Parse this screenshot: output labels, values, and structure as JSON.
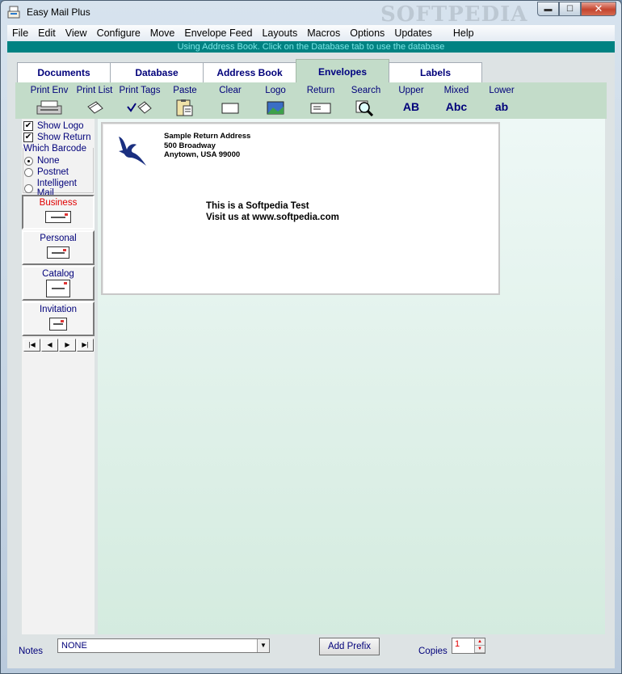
{
  "window": {
    "title": "Easy Mail Plus",
    "watermark": "SOFTPEDIA",
    "controls": {
      "minimize": "▬",
      "maximize": "☐",
      "close": "✕"
    }
  },
  "menu": [
    "File",
    "Edit",
    "View",
    "Configure",
    "Move",
    "Envelope Feed",
    "Layouts",
    "Macros",
    "Options",
    "Updates",
    "Help"
  ],
  "status_message": "Using Address Book. Click on the Database tab to use the database",
  "tabs": [
    {
      "label": "Documents",
      "active": false
    },
    {
      "label": "Database",
      "active": false
    },
    {
      "label": "Address Book",
      "active": false
    },
    {
      "label": "Envelopes",
      "active": true
    },
    {
      "label": "Labels",
      "active": false
    }
  ],
  "toolbar": [
    {
      "label": "Print Env",
      "icon": "printer-icon"
    },
    {
      "label": "Print List",
      "icon": "tags-icon"
    },
    {
      "label": "Print Tags",
      "icon": "check-tags-icon"
    },
    {
      "label": "Paste",
      "icon": "paste-icon"
    },
    {
      "label": "Clear",
      "icon": "blank-envelope-icon"
    },
    {
      "label": "Logo",
      "icon": "logo-image-icon"
    },
    {
      "label": "Return",
      "icon": "return-address-icon"
    },
    {
      "label": "Search",
      "icon": "magnifier-icon"
    },
    {
      "label": "Upper",
      "text": "AB"
    },
    {
      "label": "Mixed",
      "text": "Abc"
    },
    {
      "label": "Lower",
      "text": "ab"
    }
  ],
  "options": {
    "show_logo": {
      "label": "Show Logo",
      "checked": true
    },
    "show_return": {
      "label": "Show Return",
      "checked": true
    },
    "barcode_title": "Which Barcode",
    "barcode_options": [
      {
        "label": "None",
        "selected": true
      },
      {
        "label": "Postnet",
        "selected": false
      },
      {
        "label": "Intelligent Mail",
        "selected": false
      }
    ]
  },
  "envelope_types": [
    {
      "label": "Business",
      "selected": true
    },
    {
      "label": "Personal",
      "selected": false
    },
    {
      "label": "Catalog",
      "selected": false
    },
    {
      "label": "Invitation",
      "selected": false
    }
  ],
  "nav_buttons": [
    "|◀",
    "◀",
    "▶",
    "▶|"
  ],
  "envelope": {
    "return_address": [
      "Sample Return Address",
      "500 Broadway",
      "Anytown,  USA  99000"
    ],
    "address": [
      "This is a Softpedia Test",
      "Visit us at www.softpedia.com"
    ]
  },
  "bottom": {
    "notes_label": "Notes",
    "notes_value": "NONE",
    "add_prefix_label": "Add Prefix",
    "copies_label": "Copies",
    "copies_value": "1"
  },
  "colors": {
    "accent_teal": "#008282",
    "tab_active": "#c3dcc9",
    "label_blue": "#00007a",
    "selected_red": "#e00000"
  }
}
